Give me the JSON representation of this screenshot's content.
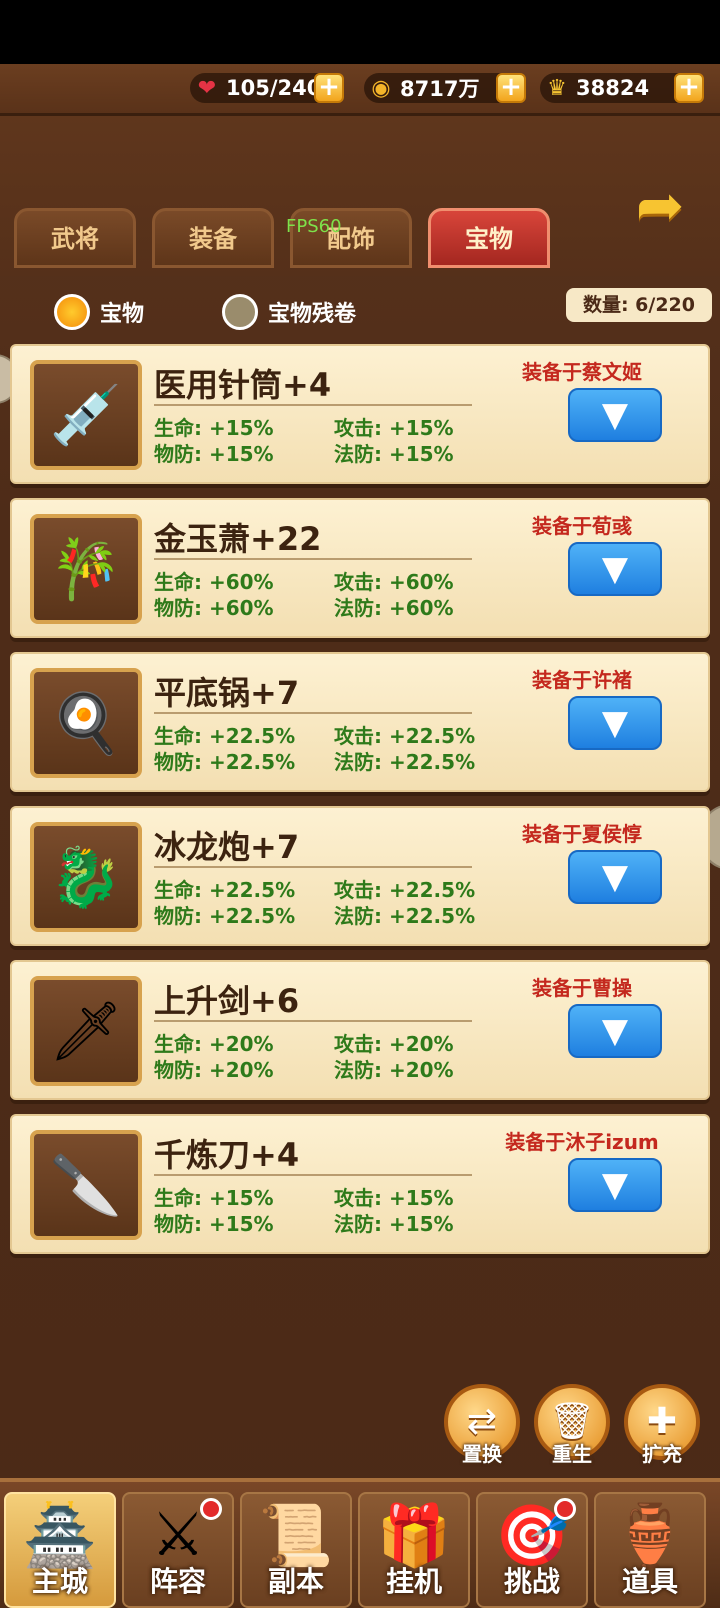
{
  "resources": [
    {
      "icon": "hearts-icon",
      "value": "105/240"
    },
    {
      "icon": "coin-icon",
      "value": "8717万"
    },
    {
      "icon": "gold-ingot-icon",
      "value": "38824"
    }
  ],
  "tabs": [
    {
      "label": "武将",
      "active": false
    },
    {
      "label": "装备",
      "active": false
    },
    {
      "label": "配饰",
      "active": false
    },
    {
      "label": "宝物",
      "active": true
    }
  ],
  "fps_label": "FPS60",
  "filter": {
    "option1": "宝物",
    "option2": "宝物残卷",
    "count": "数量: 6/220"
  },
  "items": [
    {
      "name": "医用针筒+4",
      "equipped": "装备于蔡文姬",
      "icon": "syringe-icon",
      "hp": "生命: +15%",
      "atk": "攻击: +15%",
      "pdef": "物防: +15%",
      "mdef": "法防: +15%"
    },
    {
      "name": "金玉萧+22",
      "equipped": "装备于荀彧",
      "icon": "flute-icon",
      "hp": "生命: +60%",
      "atk": "攻击: +60%",
      "pdef": "物防: +60%",
      "mdef": "法防: +60%"
    },
    {
      "name": "平底锅+7",
      "equipped": "装备于许褚",
      "icon": "frying-pan-icon",
      "hp": "生命: +22.5%",
      "atk": "攻击: +22.5%",
      "pdef": "物防: +22.5%",
      "mdef": "法防: +22.5%"
    },
    {
      "name": "冰龙炮+7",
      "equipped": "装备于夏侯惇",
      "icon": "ice-dragon-cannon-icon",
      "hp": "生命: +22.5%",
      "atk": "攻击: +22.5%",
      "pdef": "物防: +22.5%",
      "mdef": "法防: +22.5%"
    },
    {
      "name": "上升剑+6",
      "equipped": "装备于曹操",
      "icon": "sword-icon",
      "hp": "生命: +20%",
      "atk": "攻击: +20%",
      "pdef": "物防: +20%",
      "mdef": "法防: +20%"
    },
    {
      "name": "千炼刀+4",
      "equipped": "装备于沐子izum",
      "icon": "blade-icon",
      "hp": "生命: +15%",
      "atk": "攻击: +15%",
      "pdef": "物防: +15%",
      "mdef": "法防: +15%"
    }
  ],
  "actions": [
    {
      "label": "置换",
      "icon": "swap-icon"
    },
    {
      "label": "重生",
      "icon": "trash-icon"
    },
    {
      "label": "扩充",
      "icon": "expand-icon"
    }
  ],
  "nav": [
    {
      "label": "主城",
      "icon": "palace-icon",
      "active": true,
      "badge": false
    },
    {
      "label": "阵容",
      "icon": "lineup-icon",
      "active": false,
      "badge": true
    },
    {
      "label": "副本",
      "icon": "dungeon-icon",
      "active": false,
      "badge": false
    },
    {
      "label": "挂机",
      "icon": "idle-icon",
      "active": false,
      "badge": false
    },
    {
      "label": "挑战",
      "icon": "challenge-icon",
      "active": false,
      "badge": true
    },
    {
      "label": "道具",
      "icon": "items-icon",
      "active": false,
      "badge": false
    }
  ]
}
